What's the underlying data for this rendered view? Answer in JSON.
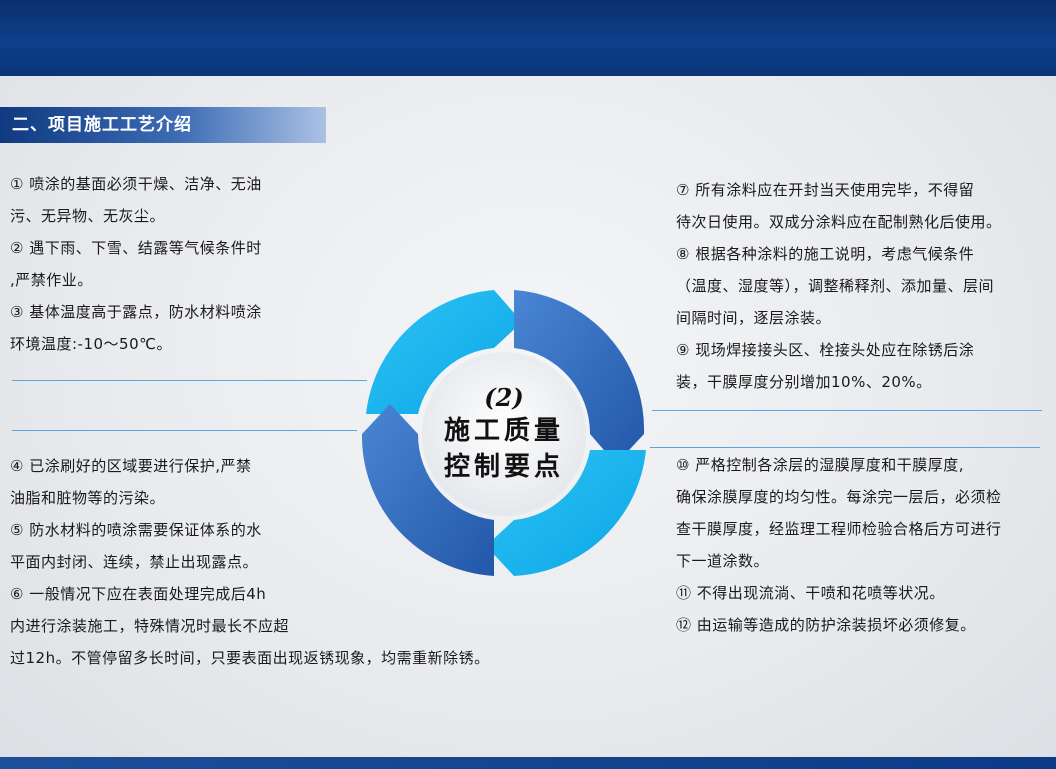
{
  "section_title": "二、项目施工工艺介绍",
  "center": {
    "number": "(2)",
    "line1": "施工质量",
    "line2": "控制要点"
  },
  "left_top": [
    "  ① 喷涂的基面必须干燥、洁净、无油",
    "污、无异物、无灰尘。",
    "  ② 遇下雨、下雪、结露等气候条件时",
    ",严禁作业。",
    "  ③ 基体温度高于露点，防水材料喷涂",
    "环境温度:-10～50℃。"
  ],
  "left_bottom": [
    "  ④ 已涂刷好的区域要进行保护,严禁",
    "油脂和脏物等的污染。",
    "  ⑤ 防水材料的喷涂需要保证体系的水",
    "平面内封闭、连续，禁止出现露点。",
    "  ⑥ 一般情况下应在表面处理完成后4h",
    "内进行涂装施工，特殊情况时最长不应超",
    "过12h。不管停留多长时间，只要表面出现返锈现象，均需重新除锈。"
  ],
  "right_top": [
    "  ⑦ 所有涂料应在开封当天使用完毕，不得留",
    "待次日使用。双成分涂料应在配制熟化后使用。",
    "  ⑧ 根据各种涂料的施工说明，考虑气候条件",
    "（温度、湿度等），调整稀释剂、添加量、层间",
    "间隔时间，逐层涂装。",
    "  ⑨ 现场焊接接头区、栓接头处应在除锈后涂",
    "装，干膜厚度分别增加10%、20%。"
  ],
  "right_bottom": [
    "  ⑩ 严格控制各涂层的湿膜厚度和干膜厚度,",
    "确保涂膜厚度的均匀性。每涂完一层后，必须检",
    "查干膜厚度，经监理工程师检验合格后方可进行",
    "下一道涂数。",
    "  ⑪ 不得出现流淌、干喷和花喷等状况。",
    "  ⑫ 由运输等造成的防护涂装损坏必须修复。"
  ],
  "colors": {
    "header_navy": "#0e3f8a",
    "arrow_light": "#14b3ee",
    "arrow_dark": "#2f6fc0",
    "divider": "#5aa7dd"
  },
  "icons": [
    "cycle-arrows-diagram"
  ]
}
